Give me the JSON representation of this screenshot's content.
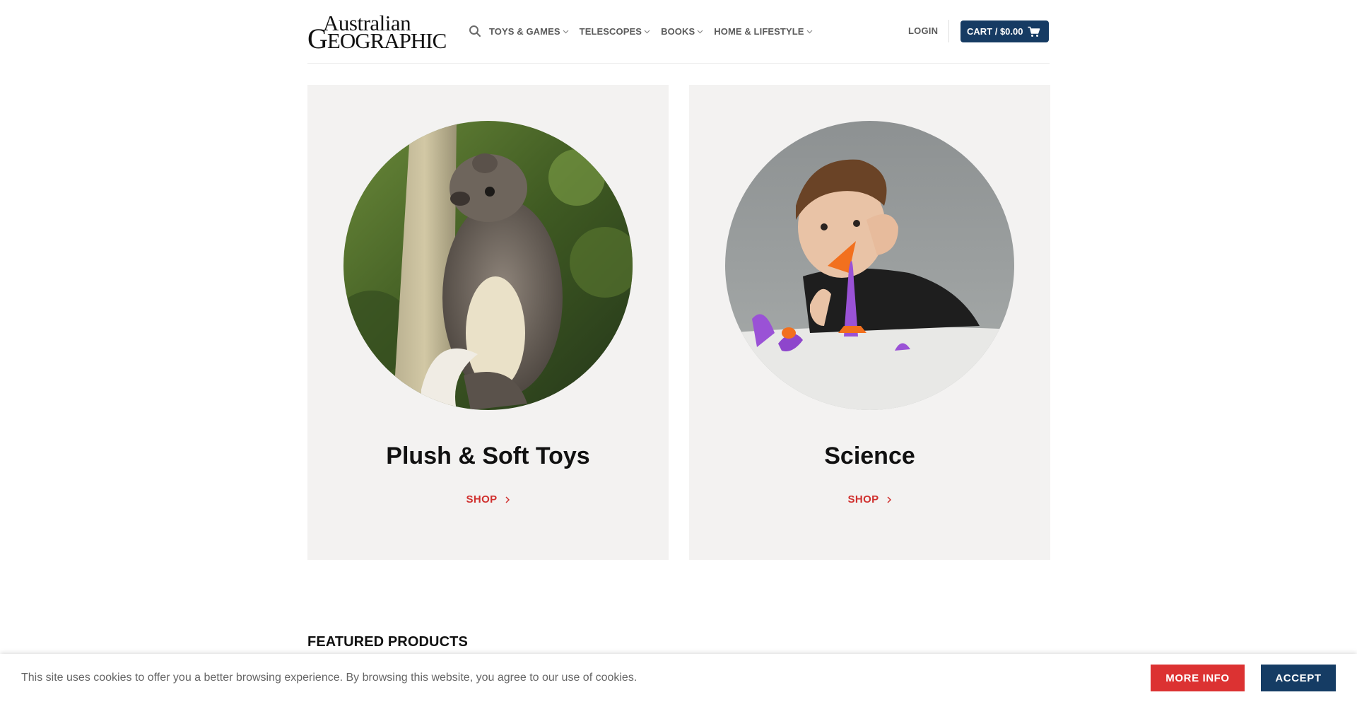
{
  "brand": {
    "logo_line1": "Australian",
    "logo_line2_initial": "G",
    "logo_line2_rest": "EOGRAPHIC"
  },
  "header": {
    "search_icon": "search-icon",
    "nav": [
      {
        "label": "TOYS & GAMES"
      },
      {
        "label": "TELESCOPES"
      },
      {
        "label": "BOOKS"
      },
      {
        "label": "HOME & LIFESTYLE"
      }
    ],
    "login_label": "LOGIN",
    "cart_label": "CART / $0.00",
    "cart_icon": "cart-icon"
  },
  "categories": [
    {
      "title": "Plush & Soft Toys",
      "link_label": "SHOP",
      "image": "possum-plush-photo"
    },
    {
      "title": "Science",
      "link_label": "SHOP",
      "image": "boy-with-rocket-toy-photo"
    }
  ],
  "featured": {
    "heading": "FEATURED PRODUCTS"
  },
  "cookie": {
    "message": "This site uses cookies to offer you a better browsing experience. By browsing this website, you agree to our use of cookies.",
    "more_info_label": "MORE INFO",
    "accept_label": "ACCEPT"
  },
  "colors": {
    "cart_bg": "#163b63",
    "shop_link": "#d0302e",
    "card_bg": "#f3f2f1",
    "more_info_bg": "#dc3232",
    "accept_bg": "#153c64"
  }
}
